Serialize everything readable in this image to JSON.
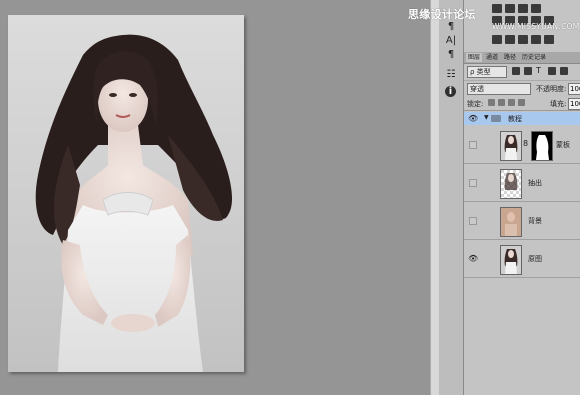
{
  "watermark": {
    "title": "思缘设计论坛",
    "url": "WWW.MISSYUAN.COM"
  },
  "toolbar": {
    "icons": [
      "paragraph-icon",
      "type-icon",
      "character-icon",
      "paragraph-style-icon",
      "info-icon"
    ],
    "labels": [
      "¶",
      "A|",
      "¶",
      "☷",
      "i"
    ]
  },
  "panel": {
    "tabs": [
      "图层",
      "通道",
      "路径",
      "历史记录"
    ],
    "filter": {
      "kind_label": "ρ 类型",
      "options": [
        "类型"
      ]
    },
    "blend": {
      "mode": "穿透",
      "opacity_label": "不透明度:",
      "opacity_value": "100"
    },
    "lock": {
      "label": "锁定:",
      "fill_label": "填充:",
      "fill_value": "100"
    },
    "group": {
      "name": "教程",
      "collapse_arrow": "▼"
    },
    "layers": [
      {
        "name": "蒙板",
        "visible": false,
        "has_mask": true,
        "thumb": "portrait"
      },
      {
        "name": "抽出",
        "visible": false,
        "has_mask": false,
        "thumb": "transparent"
      },
      {
        "name": "背景",
        "visible": false,
        "has_mask": false,
        "thumb": "portrait-warm"
      },
      {
        "name": "原图",
        "visible": true,
        "has_mask": false,
        "thumb": "portrait"
      }
    ],
    "eye_glyph": "👁",
    "chain_glyph": "8"
  },
  "colors": {
    "selection": "#a9c8ee",
    "panel_bg": "#c4c4c4",
    "canvas_bg": "#959595"
  }
}
